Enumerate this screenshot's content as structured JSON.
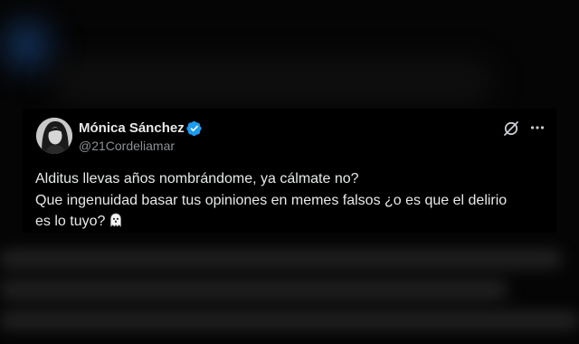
{
  "tweet": {
    "author_name": "Mónica Sánchez",
    "handle": "@21Cordeliamar",
    "verified": true,
    "text_lines": [
      "Alditus llevas años nombrándome, ya cálmate no?",
      "Que ingenuidad basar tus opiniones en memes falsos ¿o es que el delirio",
      "es lo tuyo?"
    ],
    "emoji": "ghost-icon"
  },
  "icons": {
    "verified": "verified-badge-icon",
    "grok": "grok-icon",
    "more": "more-options-icon",
    "avatar": "avatar"
  },
  "colors": {
    "background": "#050505",
    "card": "#000000",
    "text_primary": "#e7e9ea",
    "text_secondary": "#8b8f94",
    "verified_blue": "#1d9bf0"
  }
}
